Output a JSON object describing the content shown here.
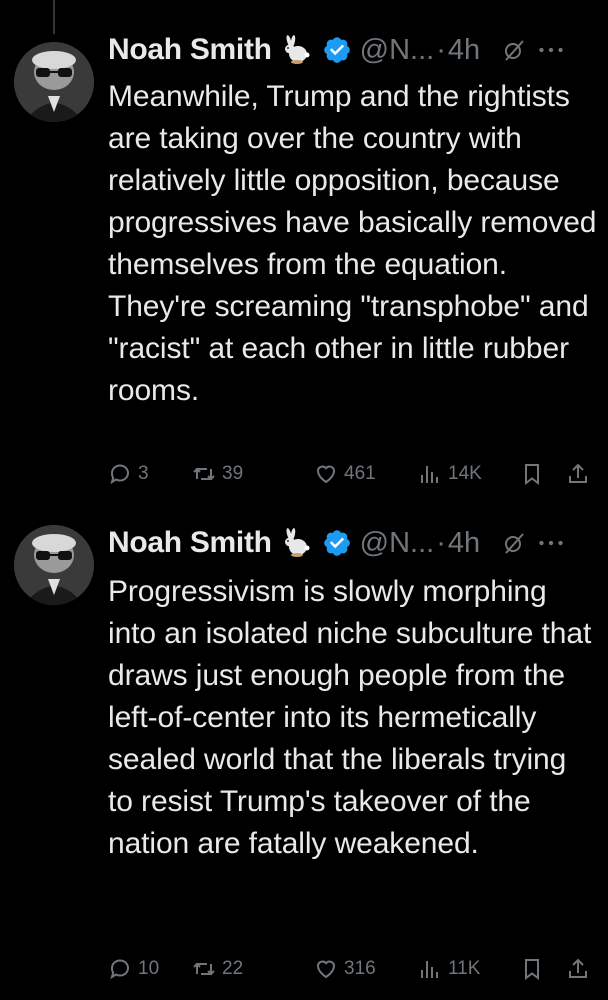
{
  "tweets": [
    {
      "name": "Noah Smith",
      "handle": "@N...",
      "separator": "·",
      "time": "4h",
      "text": "Meanwhile, Trump and the rightists are taking over the country with relatively little opposition, because progressives have basically removed themselves from the equation. They're screaming \"transphobe\" and \"racist\" at each other in little rubber rooms.",
      "replies": "3",
      "retweets": "39",
      "likes": "461",
      "views": "14K"
    },
    {
      "name": "Noah Smith",
      "handle": "@N...",
      "separator": "·",
      "time": "4h",
      "text": "Progressivism is slowly morphing into an isolated niche subculture that draws just enough people from the left-of-center into its hermetically sealed world that the liberals trying to resist Trump's takeover of the nation are fatally weakened.",
      "replies": "10",
      "retweets": "22",
      "likes": "316",
      "views": "11K"
    }
  ],
  "colors": {
    "background": "#000000",
    "text": "#e7e9ea",
    "muted": "#71767b",
    "verified": "#1d9bf0"
  },
  "icons": [
    "rabbit-emoji-icon",
    "verified-badge-icon",
    "grok-icon",
    "more-icon",
    "reply-icon",
    "retweet-icon",
    "like-icon",
    "views-icon",
    "bookmark-icon",
    "share-icon"
  ]
}
